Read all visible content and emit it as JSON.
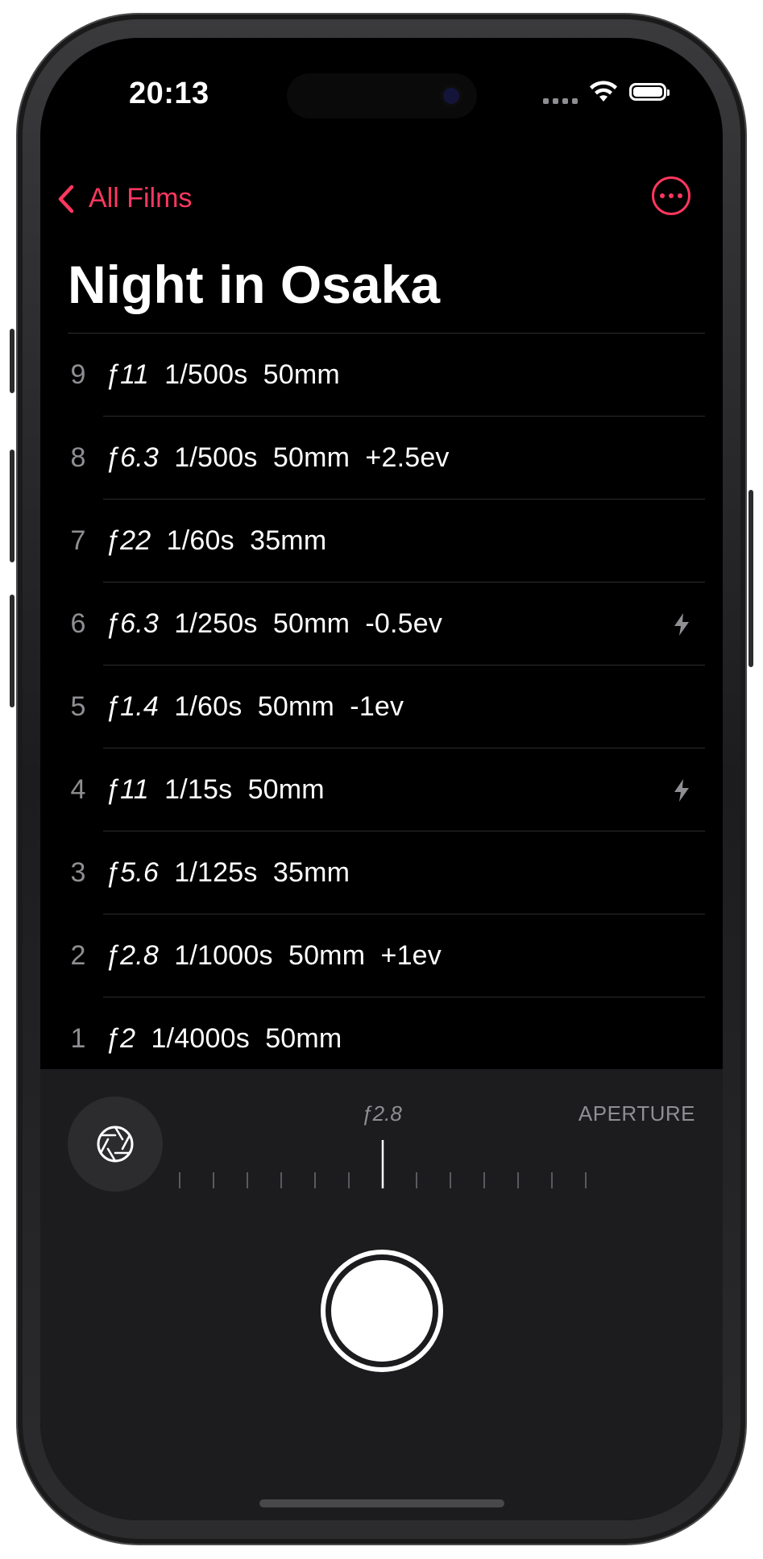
{
  "status_bar": {
    "time": "20:13"
  },
  "nav": {
    "back_label": "All Films"
  },
  "page": {
    "title": "Night in Osaka"
  },
  "colors": {
    "accent": "#ff375f",
    "background": "#000000",
    "panel": "#1c1c1e",
    "secondary_text": "#8e8e93"
  },
  "shots": [
    {
      "num": "9",
      "aperture": "ƒ11",
      "settings": "  1/500s  50mm",
      "flash": false
    },
    {
      "num": "8",
      "aperture": "ƒ6.3",
      "settings": "  1/500s  50mm  +2.5ev",
      "flash": false
    },
    {
      "num": "7",
      "aperture": "ƒ22",
      "settings": "  1/60s  35mm",
      "flash": false
    },
    {
      "num": "6",
      "aperture": "ƒ6.3",
      "settings": "  1/250s  50mm  -0.5ev",
      "flash": true
    },
    {
      "num": "5",
      "aperture": "ƒ1.4",
      "settings": "  1/60s  50mm  -1ev",
      "flash": false
    },
    {
      "num": "4",
      "aperture": "ƒ11",
      "settings": "  1/15s  50mm",
      "flash": true
    },
    {
      "num": "3",
      "aperture": "ƒ5.6",
      "settings": "  1/125s  35mm",
      "flash": false
    },
    {
      "num": "2",
      "aperture": "ƒ2.8",
      "settings": "  1/1000s  50mm  +1ev",
      "flash": false
    },
    {
      "num": "1",
      "aperture": "ƒ2",
      "settings": "  1/4000s  50mm",
      "flash": false
    }
  ],
  "control_panel": {
    "dial_value": "ƒ2.8",
    "dial_label": "APERTURE",
    "aperture_icon": "aperture-icon",
    "shutter_icon": "shutter-button"
  }
}
